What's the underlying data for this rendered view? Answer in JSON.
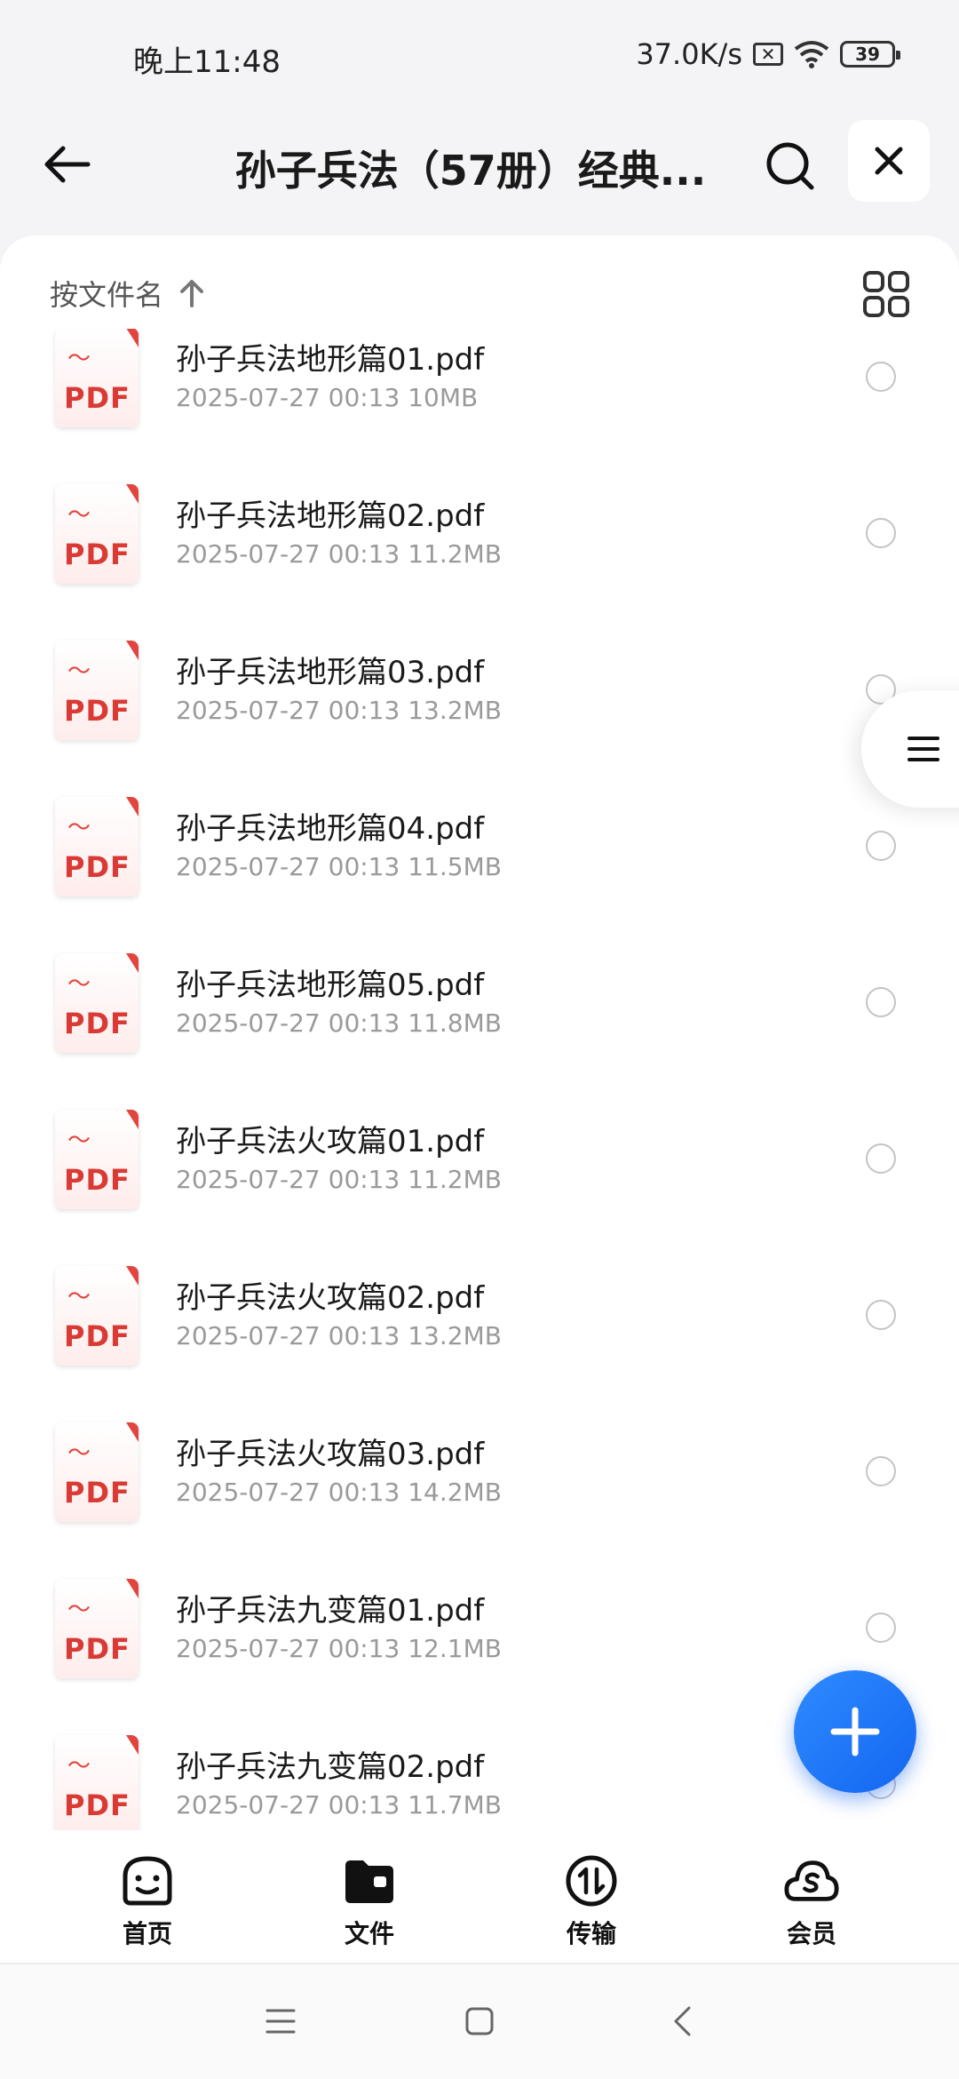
{
  "status_bar": {
    "time": "晚上11:48",
    "net_speed": "37.0K/s",
    "battery": "39"
  },
  "header": {
    "title": "孙子兵法（57册）经典..."
  },
  "sort": {
    "label": "按文件名"
  },
  "files": [
    {
      "name": "孙子兵法地形篇01.pdf",
      "date": "2025-07-27 00:13",
      "size": "10MB"
    },
    {
      "name": "孙子兵法地形篇02.pdf",
      "date": "2025-07-27 00:13",
      "size": "11.2MB"
    },
    {
      "name": "孙子兵法地形篇03.pdf",
      "date": "2025-07-27 00:13",
      "size": "13.2MB"
    },
    {
      "name": "孙子兵法地形篇04.pdf",
      "date": "2025-07-27 00:13",
      "size": "11.5MB"
    },
    {
      "name": "孙子兵法地形篇05.pdf",
      "date": "2025-07-27 00:13",
      "size": "11.8MB"
    },
    {
      "name": "孙子兵法火攻篇01.pdf",
      "date": "2025-07-27 00:13",
      "size": "11.2MB"
    },
    {
      "name": "孙子兵法火攻篇02.pdf",
      "date": "2025-07-27 00:13",
      "size": "13.2MB"
    },
    {
      "name": "孙子兵法火攻篇03.pdf",
      "date": "2025-07-27 00:13",
      "size": "14.2MB"
    },
    {
      "name": "孙子兵法九变篇01.pdf",
      "date": "2025-07-27 00:13",
      "size": "12.1MB"
    },
    {
      "name": "孙子兵法九变篇02.pdf",
      "date": "2025-07-27 00:13",
      "size": "11.7MB"
    }
  ],
  "file_icon_label": "PDF",
  "bottom_nav": [
    {
      "label": "首页",
      "icon": "smile-face-icon"
    },
    {
      "label": "文件",
      "icon": "folder-icon"
    },
    {
      "label": "传输",
      "icon": "transfer-icon"
    },
    {
      "label": "会员",
      "icon": "cloud-s-icon"
    }
  ],
  "colors": {
    "accent": "#1a6ff2",
    "pdf_red": "#d93a34",
    "background": "#f4f4f6"
  }
}
